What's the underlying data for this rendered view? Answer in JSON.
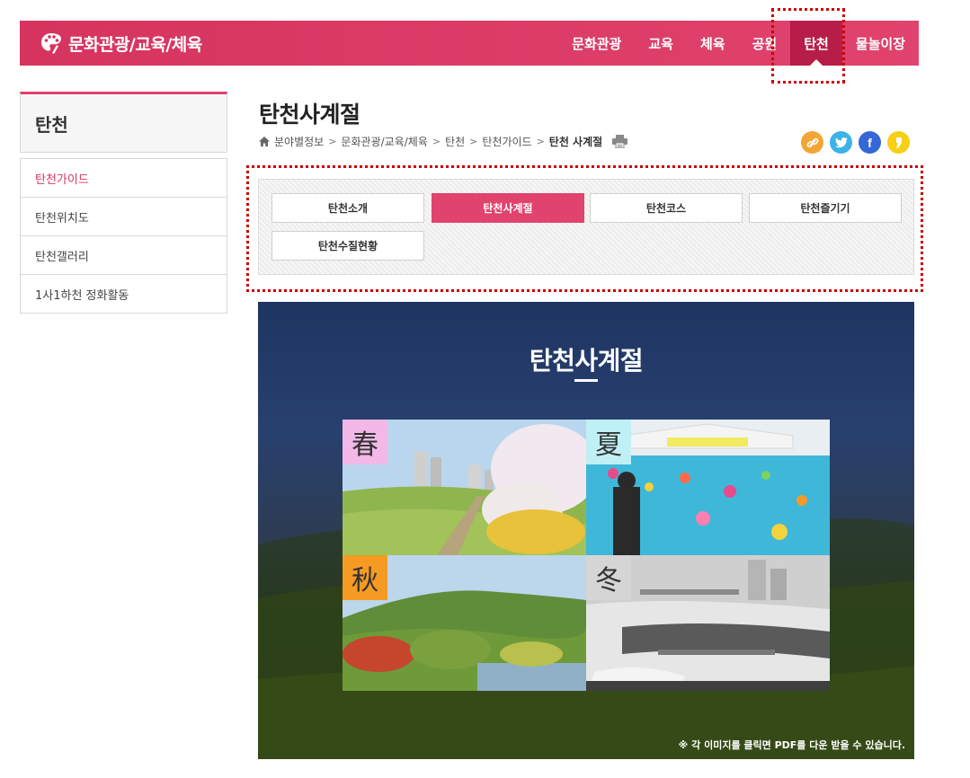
{
  "header": {
    "logo_text": "문화관광/교육/체육",
    "nav": [
      "문화관광",
      "교육",
      "체육",
      "공원",
      "탄천",
      "물놀이장"
    ],
    "active_nav": "탄천",
    "accent": "#e0436d"
  },
  "sidebar": {
    "title": "탄천",
    "items": [
      {
        "label": "탄천가이드",
        "active": true
      },
      {
        "label": "탄천위치도"
      },
      {
        "label": "탄천갤러리"
      },
      {
        "label": "1사1하천 정화활동"
      }
    ]
  },
  "content": {
    "title": "탄천사계절",
    "breadcrumb": [
      "분야별정보",
      "문화관광/교육/체육",
      "탄천",
      "탄천가이드",
      "탄천 사계절"
    ],
    "share_icons": [
      "link-icon",
      "twitter-icon",
      "facebook-icon",
      "kakaostory-icon"
    ],
    "tabs": [
      {
        "label": "탄천소개"
      },
      {
        "label": "탄천사계절",
        "active": true
      },
      {
        "label": "탄천코스"
      },
      {
        "label": "탄천즐기기"
      },
      {
        "label": "탄천수질현황"
      }
    ]
  },
  "visual": {
    "title": "탄천사계절",
    "seasons": [
      {
        "char": "春",
        "color": "#f3b8e8"
      },
      {
        "char": "夏",
        "color": "#bff0f5"
      },
      {
        "char": "秋",
        "color": "#f59a22"
      },
      {
        "char": "冬",
        "color": "#d5d5d5"
      }
    ],
    "notice": "※ 각 이미지를 클릭면 PDF를 다운 받을 수 있습니다."
  }
}
